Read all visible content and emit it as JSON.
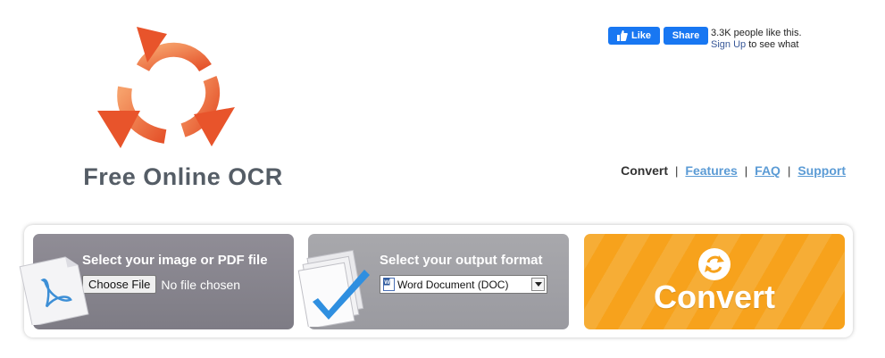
{
  "logo": {
    "title": "Free Online OCR",
    "icon": "recycle-arrows-icon",
    "colors": [
      "#e8542b",
      "#f39a5c"
    ]
  },
  "social": {
    "like_label": "Like",
    "share_label": "Share",
    "count_text": "3.3K people like this.",
    "signup_link": "Sign Up",
    "signup_suffix": " to see what",
    "brand_color": "#1877f2"
  },
  "nav": {
    "current": "Convert",
    "links": [
      "Features",
      "FAQ",
      "Support"
    ],
    "separator": "|",
    "link_color": "#5b9bd5"
  },
  "steps": {
    "select_file": {
      "label": "Select your image or PDF file",
      "button_label": "Choose File",
      "status": "No file chosen",
      "icon": "pdf-document-icon"
    },
    "output_format": {
      "label": "Select your output format",
      "selected": "Word Document (DOC)",
      "icon": "documents-checkmark-icon"
    },
    "convert": {
      "label": "Convert",
      "icon": "convert-arrows-icon",
      "color": "#f7a21c"
    }
  }
}
